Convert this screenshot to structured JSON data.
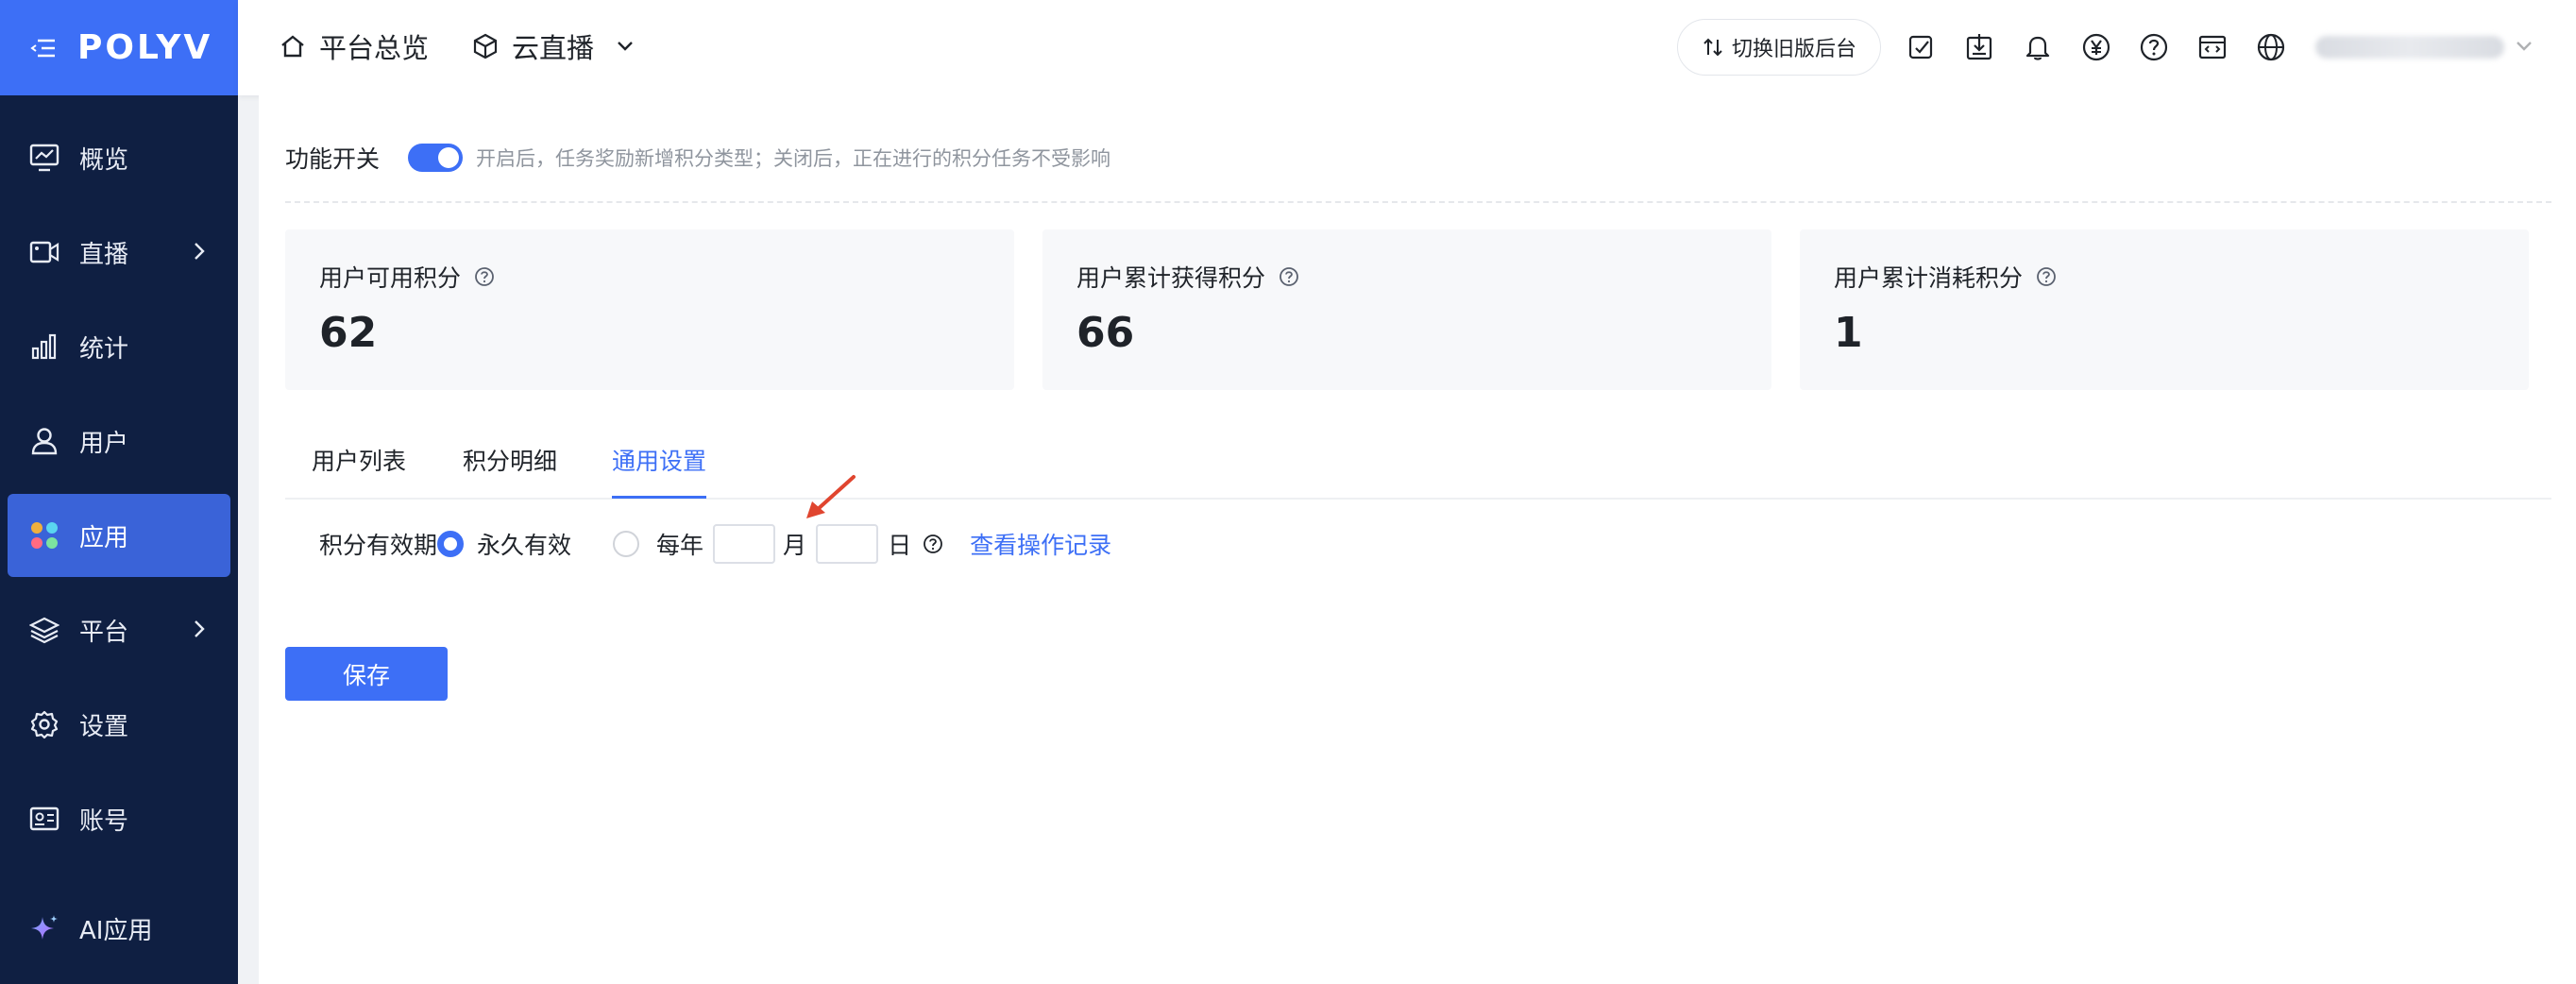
{
  "app": {
    "logo": "POLYV"
  },
  "sidebar": {
    "items": [
      {
        "label": "概览",
        "icon": "monitor-icon",
        "has_arrow": false,
        "active": false
      },
      {
        "label": "直播",
        "icon": "video-camera-icon",
        "has_arrow": true,
        "active": false
      },
      {
        "label": "统计",
        "icon": "bar-chart-icon",
        "has_arrow": false,
        "active": false
      },
      {
        "label": "用户",
        "icon": "user-icon",
        "has_arrow": false,
        "active": false
      },
      {
        "label": "应用",
        "icon": "apps-icon",
        "has_arrow": false,
        "active": true
      },
      {
        "label": "平台",
        "icon": "layers-icon",
        "has_arrow": true,
        "active": false
      },
      {
        "label": "设置",
        "icon": "gear-icon",
        "has_arrow": false,
        "active": false
      },
      {
        "label": "账号",
        "icon": "id-card-icon",
        "has_arrow": false,
        "active": false
      },
      {
        "label": "AI应用",
        "icon": "sparkle-icon",
        "has_arrow": false,
        "active": false
      }
    ]
  },
  "header": {
    "nav1": "平台总览",
    "nav2": "云直播",
    "switch_old": "切换旧版后台",
    "icons": [
      "edit-icon",
      "download-icon",
      "bell-icon",
      "yen-icon",
      "help-icon",
      "code-window-icon",
      "globe-icon"
    ]
  },
  "feature": {
    "label": "功能开关",
    "enabled": true,
    "desc": "开启后，任务奖励新增积分类型；关闭后，正在进行的积分任务不受影响"
  },
  "stats": [
    {
      "label": "用户可用积分",
      "value": "62"
    },
    {
      "label": "用户累计获得积分",
      "value": "66"
    },
    {
      "label": "用户累计消耗积分",
      "value": "1"
    }
  ],
  "tabs": [
    {
      "label": "用户列表",
      "active": false
    },
    {
      "label": "积分明细",
      "active": false
    },
    {
      "label": "通用设置",
      "active": true
    }
  ],
  "settings": {
    "validity_label": "积分有效期",
    "option_forever": "永久有效",
    "option_yearly": "每年",
    "month_unit": "月",
    "day_unit": "日",
    "month_value": "",
    "day_value": "",
    "selected": "forever",
    "view_log": "查看操作记录"
  },
  "save_label": "保存",
  "colors": {
    "primary": "#3d6ff6",
    "sidebar_bg": "#0f1f42",
    "active_item": "#3a63d8",
    "arrow": "#e0452f"
  }
}
